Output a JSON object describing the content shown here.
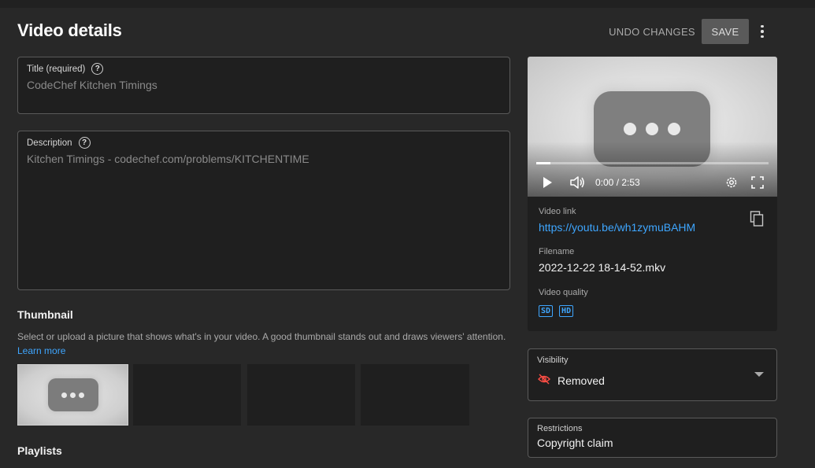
{
  "header": {
    "title": "Video details",
    "undo_label": "UNDO CHANGES",
    "save_label": "SAVE",
    "more_icon": "more-vert-icon"
  },
  "title_field": {
    "label": "Title (required)",
    "value": "CodeChef Kitchen Timings",
    "help_icon": "?"
  },
  "description_field": {
    "label": "Description",
    "value": "Kitchen Timings -  codechef.com/problems/KITCHENTIME",
    "help_icon": "?"
  },
  "thumbnail": {
    "heading": "Thumbnail",
    "description": "Select or upload a picture that shows what's in your video. A good thumbnail stands out and draws viewers' attention.",
    "learn_more": "Learn more",
    "options": [
      {
        "state": "selected",
        "content": "processing-placeholder-icon"
      },
      {
        "state": "empty"
      },
      {
        "state": "empty"
      },
      {
        "state": "empty"
      }
    ]
  },
  "playlists": {
    "heading": "Playlists"
  },
  "player": {
    "time": "0:00 / 2:53",
    "progress": 0.06,
    "icons": [
      "play-icon",
      "volume-icon",
      "gear-icon",
      "fullscreen-icon"
    ]
  },
  "video_info": {
    "link_label": "Video link",
    "link_value": "https://youtu.be/wh1zymuBAHM",
    "filename_label": "Filename",
    "filename_value": "2022-12-22 18-14-52.mkv",
    "quality_label": "Video quality",
    "quality_badges": [
      "SD",
      "HD"
    ]
  },
  "visibility": {
    "label": "Visibility",
    "value": "Removed",
    "icon_color": "#ff4e45"
  },
  "restrictions": {
    "label": "Restrictions",
    "value": "Copyright claim"
  },
  "colors": {
    "background": "#282828",
    "panel": "#1f1f1f",
    "link": "#3ea6ff",
    "save_button": "#5a5a5a"
  }
}
